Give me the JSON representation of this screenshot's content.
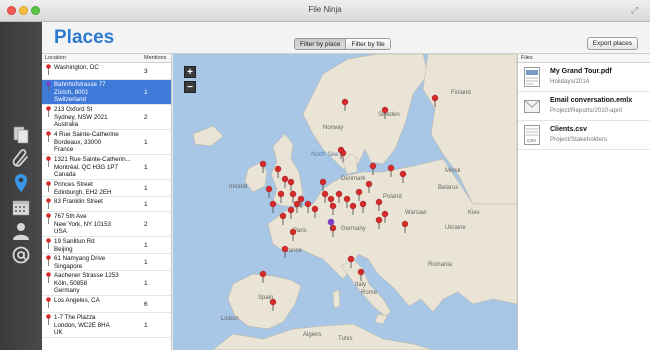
{
  "window": {
    "title": "File Ninja"
  },
  "header": {
    "title": "Places",
    "filter_place": "Filter by place",
    "filter_file": "Filter by file",
    "export_label": "Export places"
  },
  "locations": {
    "col_location": "Location",
    "col_mentions": "Mentions",
    "rows": [
      {
        "text": "Washington, DC",
        "mentions": "3",
        "selected": false
      },
      {
        "text": "Bahnhofstrasse 77\nZürich, 8001\nSwitzerland",
        "mentions": "1",
        "selected": true
      },
      {
        "text": "213 Oxford St\nSydney, NSW 2021\nAustralia",
        "mentions": "2",
        "selected": false
      },
      {
        "text": "4 Rue Sainte-Catherine\nBordeaux, 33000\nFrance",
        "mentions": "1",
        "selected": false
      },
      {
        "text": "1321 Rue Sainte-Catherin...\nMontréal, QC H3G 1P7\nCanada",
        "mentions": "1",
        "selected": false
      },
      {
        "text": "Princes Street\nEdinburgh, EH2 2EH",
        "mentions": "1",
        "selected": false
      },
      {
        "text": "83 Franklin Street",
        "mentions": "1",
        "selected": false
      },
      {
        "text": "767 5th Ave\nNew York, NY 10153\nUSA",
        "mentions": "2",
        "selected": false
      },
      {
        "text": "19 Sanlitun Rd\nBeijing",
        "mentions": "1",
        "selected": false
      },
      {
        "text": "61 Namyang Drive\nSingapore",
        "mentions": "1",
        "selected": false
      },
      {
        "text": "Aachener Strasse 1253\nKöln, 50858\nGermany",
        "mentions": "1",
        "selected": false
      },
      {
        "text": "Los Angeles, CA",
        "mentions": "6",
        "selected": false
      },
      {
        "text": "1-7 The Plazza\nLondon, WC2E 8HA\nUK",
        "mentions": "1",
        "selected": false
      }
    ]
  },
  "map": {
    "zoom_in": "+",
    "zoom_out": "−",
    "labels": {
      "sweden": "Sweden",
      "finland": "Finland",
      "norway": "Norway",
      "north_sea": "North Sea",
      "denmark": "Denmark",
      "ireland": "Ireland",
      "poland": "Poland",
      "belarus": "Belarus",
      "ukraine": "Ukraine",
      "paris": "Paris",
      "france": "France",
      "romania": "Romania",
      "spain": "Spain",
      "italy": "Italy",
      "lisbon": "Lisbon",
      "tunis": "Tunis",
      "algiers": "Algiers",
      "warsaw": "Warsaw",
      "kiev": "Kiev",
      "rome": "Rome",
      "minsk": "Minsk",
      "germany": "Germany"
    }
  },
  "files": {
    "col_files": "Files",
    "items": [
      {
        "name": "My Grand Tour.pdf",
        "path": "Holidays/2014",
        "icon": "pdf-document-icon"
      },
      {
        "name": "Email conversation.emlx",
        "path": "Project/Reports/2010-april",
        "icon": "email-icon"
      },
      {
        "name": "Clients.csv",
        "path": "Project/Stakeholders",
        "icon": "csv-document-icon"
      }
    ]
  },
  "colors": {
    "accent": "#2b7bd0",
    "selection": "#3f7ad8",
    "sea": "#a8c6e6",
    "land": "#e9e4d6",
    "pin_red": "#d62b2b",
    "pin_purple": "#7b3fc4"
  }
}
